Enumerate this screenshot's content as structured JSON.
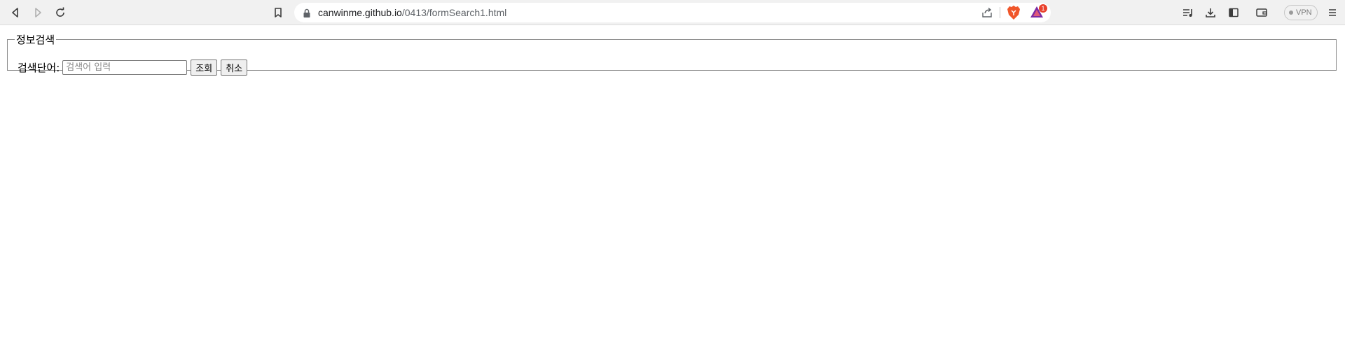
{
  "browser": {
    "url_host": "canwinme.github.io",
    "url_path": "/0413/formSearch1.html",
    "rewards_badge": "1",
    "vpn_label": "VPN",
    "icons": {
      "back": "back-arrow-icon",
      "forward": "forward-arrow-icon",
      "reload": "reload-icon",
      "bookmark": "bookmark-icon",
      "lock": "lock-icon",
      "share": "share-icon",
      "brave": "brave-shields-icon",
      "rewards": "brave-rewards-icon",
      "playlist": "playlist-icon",
      "download": "download-icon",
      "sidebar": "sidebar-icon",
      "wallet": "wallet-icon",
      "menu": "menu-icon"
    }
  },
  "form": {
    "legend": "정보검색",
    "search_label": "검색단어:",
    "search_value": "",
    "search_placeholder": "검색어 입력",
    "submit_label": "조회",
    "reset_label": "취소"
  }
}
